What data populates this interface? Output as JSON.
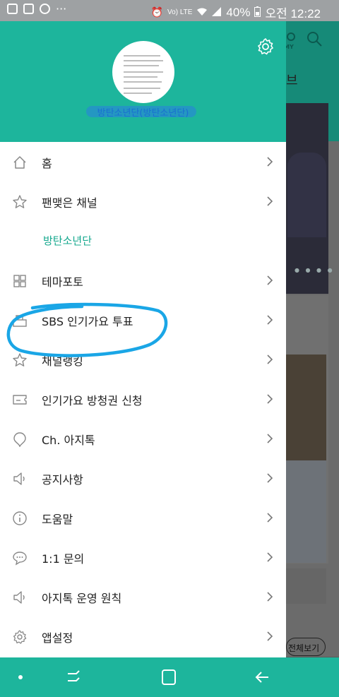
{
  "status_bar": {
    "left_icons": [
      "pill-notification-icon",
      "image-notification-icon",
      "app-notification-icon"
    ],
    "more": "···",
    "network_label": "Vo) LTE",
    "battery": "40%",
    "time": "오전 12:22"
  },
  "background_app": {
    "tab_partial": "브",
    "button_partial": "전체보기",
    "my_label": "MY"
  },
  "drawer": {
    "profile_name": "방탄소년단(방탄소년단)",
    "menu": [
      {
        "label": "홈",
        "icon": "home-icon",
        "chevron": true
      },
      {
        "label": "팬맺은 채널",
        "icon": "star-icon",
        "chevron": true
      },
      {
        "label": "방탄소년단",
        "icon": "",
        "chevron": false,
        "sub": true
      },
      {
        "label": "테마포토",
        "icon": "grid-icon",
        "chevron": true
      },
      {
        "label": "SBS 인기가요 투표",
        "icon": "vote-box-icon",
        "chevron": true
      },
      {
        "label": "채널랭킹",
        "icon": "star-icon",
        "chevron": true
      },
      {
        "label": "인기가요 방청권 신청",
        "icon": "ticket-icon",
        "chevron": true
      },
      {
        "label": "Ch. 아지톡",
        "icon": "chat-pin-icon",
        "chevron": true
      },
      {
        "label": "공지사항",
        "icon": "speaker-icon",
        "chevron": true
      },
      {
        "label": "도움말",
        "icon": "info-icon",
        "chevron": true
      },
      {
        "label": "1:1 문의",
        "icon": "speech-bubble-icon",
        "chevron": true
      },
      {
        "label": "아지톡 운영 원칙",
        "icon": "speaker-icon",
        "chevron": true
      },
      {
        "label": "앱설정",
        "icon": "gear-icon",
        "chevron": true
      }
    ]
  },
  "colors": {
    "accent": "#1db59c",
    "sub_label": "#15a88e",
    "highlight_ink": "#1aa6e6"
  }
}
